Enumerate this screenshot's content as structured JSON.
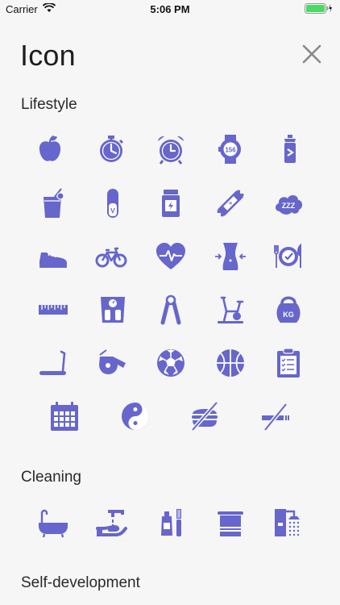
{
  "status_bar": {
    "carrier": "Carrier",
    "time": "5:06 PM"
  },
  "header": {
    "title": "Icon",
    "close_icon": "close-icon"
  },
  "accent_color": "#6666cc",
  "sections": [
    {
      "title": "Lifestyle",
      "icons": [
        "apple-icon",
        "stopwatch-icon",
        "alarm-clock-icon",
        "smartwatch-heart-rate-icon",
        "protein-shaker-icon",
        "juice-glass-icon",
        "vitamin-capsule-icon",
        "supplement-jar-icon",
        "energy-bar-icon",
        "sleep-cloud-icon",
        "sneaker-icon",
        "bicycle-icon",
        "heart-pulse-icon",
        "waist-icon",
        "diet-plate-icon",
        "measuring-ruler-icon",
        "weight-scale-icon",
        "hand-grip-icon",
        "exercise-bike-icon",
        "kettlebell-icon",
        "treadmill-icon",
        "whistle-icon",
        "soccer-ball-icon",
        "basketball-icon",
        "clipboard-checklist-icon",
        "calendar-icon",
        "yin-yang-icon",
        "no-burger-icon",
        "no-smoking-icon"
      ],
      "kettlebell_label": "KG",
      "watch_label": "156"
    },
    {
      "title": "Cleaning",
      "icons": [
        "bathtub-icon",
        "hand-wash-icon",
        "toothbrush-toothpaste-icon",
        "towel-rack-icon",
        "shower-icon"
      ]
    },
    {
      "title": "Self-development",
      "icons": []
    }
  ]
}
